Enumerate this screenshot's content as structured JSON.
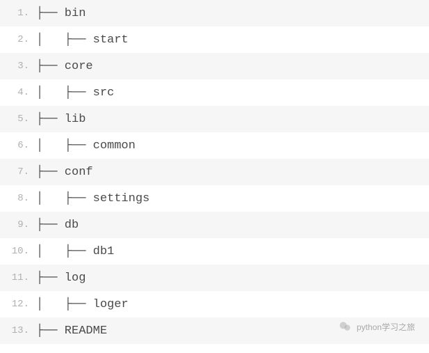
{
  "lines": [
    {
      "num": "1.",
      "text": "├── bin"
    },
    {
      "num": "2.",
      "text": "│   ├── start"
    },
    {
      "num": "3.",
      "text": "├── core"
    },
    {
      "num": "4.",
      "text": "│   ├── src"
    },
    {
      "num": "5.",
      "text": "├── lib"
    },
    {
      "num": "6.",
      "text": "│   ├── common"
    },
    {
      "num": "7.",
      "text": "├── conf"
    },
    {
      "num": "8.",
      "text": "│   ├── settings"
    },
    {
      "num": "9.",
      "text": "├── db"
    },
    {
      "num": "10.",
      "text": "│   ├── db1"
    },
    {
      "num": "11.",
      "text": "├── log"
    },
    {
      "num": "12.",
      "text": "│   ├── loger"
    },
    {
      "num": "13.",
      "text": "├── README"
    }
  ],
  "watermark": {
    "text": "python学习之旅"
  }
}
